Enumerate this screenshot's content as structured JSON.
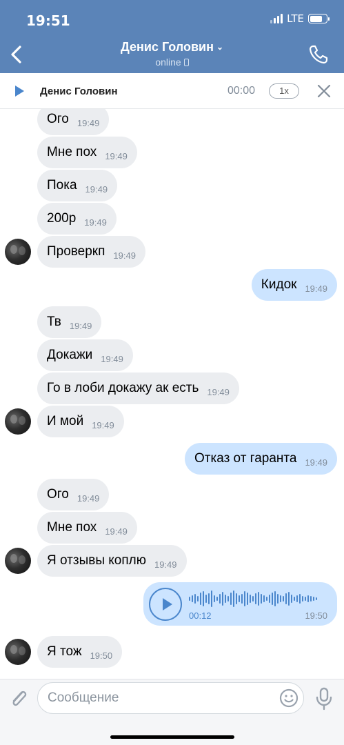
{
  "status_bar": {
    "time": "19:51",
    "network": "LTE",
    "battery_percent": 78
  },
  "header": {
    "title": "Денис Головин",
    "subtitle": "online",
    "back_icon": "chevron-left-icon",
    "call_icon": "phone-icon",
    "title_icon": "chevron-down-icon"
  },
  "audio_player": {
    "name": "Денис Головин",
    "time": "00:00",
    "speed": "1x",
    "play_icon": "play-icon",
    "close_icon": "close-icon"
  },
  "messages": [
    {
      "side": "in",
      "text": "Ого",
      "time": "19:49",
      "avatar": false
    },
    {
      "side": "in",
      "text": "Мне пох",
      "time": "19:49",
      "avatar": false
    },
    {
      "side": "in",
      "text": "Пока",
      "time": "19:49",
      "avatar": false
    },
    {
      "side": "in",
      "text": "200р",
      "time": "19:49",
      "avatar": false
    },
    {
      "side": "in",
      "text": "Проверкп",
      "time": "19:49",
      "avatar": true
    },
    {
      "side": "out",
      "text": "Кидок",
      "time": "19:49"
    },
    {
      "side": "in",
      "text": "Тв",
      "time": "19:49",
      "avatar": false
    },
    {
      "side": "in",
      "text": "Докажи",
      "time": "19:49",
      "avatar": false
    },
    {
      "side": "in",
      "text": "Го в лоби докажу ак есть",
      "time": "19:49",
      "avatar": false
    },
    {
      "side": "in",
      "text": "И мой",
      "time": "19:49",
      "avatar": true
    },
    {
      "side": "out",
      "text": "Отказ от гаранта",
      "time": "19:49"
    },
    {
      "side": "in",
      "text": "Ого",
      "time": "19:49",
      "avatar": false
    },
    {
      "side": "in",
      "text": "Мне пох",
      "time": "19:49",
      "avatar": false
    },
    {
      "side": "in",
      "text": "Я отзывы коплю",
      "time": "19:49",
      "avatar": true
    },
    {
      "side": "out",
      "voice": true,
      "duration": "00:12",
      "time": "19:50"
    },
    {
      "side": "in",
      "text": "Я тож",
      "time": "19:50",
      "avatar": true
    }
  ],
  "composer": {
    "placeholder": "Сообщение",
    "attach_icon": "paperclip-icon",
    "emoji_icon": "smiley-icon",
    "mic_icon": "microphone-icon"
  },
  "colors": {
    "header_bg": "#5b84b8",
    "incoming_bubble": "#ebedf0",
    "outgoing_bubble": "#cce4ff",
    "accent": "#4a86cc"
  }
}
